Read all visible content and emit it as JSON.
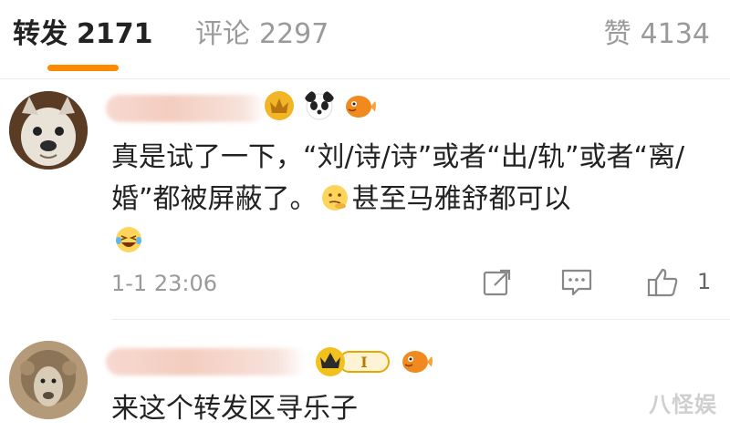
{
  "tabs": {
    "repost": {
      "label": "转发",
      "count": "2171"
    },
    "comment": {
      "label": "评论",
      "count": "2297"
    },
    "like": {
      "label": "赞",
      "count": "4134"
    }
  },
  "comments": [
    {
      "text_part1": "真是试了一下，“刘/诗/诗”或者“出/轨”或者“离/婚”都被屏蔽了。",
      "text_part2": "甚至马雅舒都可以",
      "badges": [
        "gold-badge-icon",
        "panda-icon",
        "fish-icon"
      ],
      "emojis": [
        "thinking-face-emoji",
        "laughing-tears-emoji"
      ],
      "time": "1-1 23:06",
      "like_count": "1"
    },
    {
      "text": "来这个转发区寻乐子",
      "badges": [
        "crown-level-badge-icon",
        "fish-icon"
      ],
      "level_label": "I"
    }
  ],
  "watermark": "八怪娱",
  "colors": {
    "accent": "#ff8a00",
    "muted_text": "#9a9a9a",
    "name_blur": "#f3cdbf"
  }
}
